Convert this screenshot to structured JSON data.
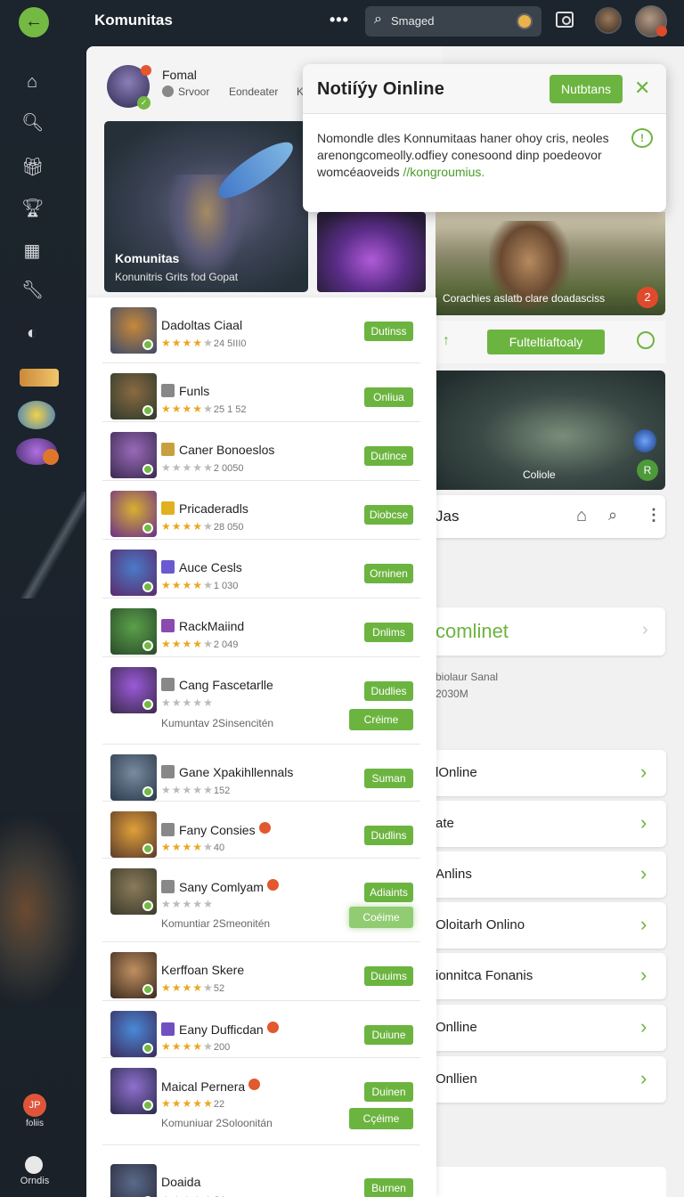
{
  "topbar": {
    "title": "Komunitas",
    "more_glyph": "•••",
    "search_value": "Smaged",
    "icons": [
      "back-arrow-icon",
      "search-icon",
      "screen-icon",
      "avatar"
    ]
  },
  "sidebar": {
    "icons": [
      "home-icon",
      "search-icon",
      "gift-icon",
      "trophy-icon",
      "calendar-icon",
      "wrench-icon",
      "globe-icon"
    ],
    "bottom_badge": "JP",
    "bottom_label1": "foliis",
    "bottom_label2": "Orndis"
  },
  "profile": {
    "name": "Fomal",
    "status": "Srvoor",
    "tab2": "Eondeater",
    "tab3": "K"
  },
  "banner": {
    "title": "Komunitas",
    "subtitle": "Konunitris Grits fod Gopat"
  },
  "notification": {
    "title": "Notiíýy Oinline",
    "button": "Nutbtans",
    "close": "✕",
    "body": "Nomondle dles Konnumitaas haner ohoy cris, neoles arenongcomeolly.odfiey conesoond dinp poedeovor womcéaoveids",
    "link": "//kongroumius."
  },
  "right": {
    "img1_caption": "Corachies aslatb clare doadasciss",
    "img1_badge": "2",
    "cta": "Fulteltiaftoaly",
    "img2_caption": "Coliole",
    "img2_badge": "R",
    "nav_title": "Jas",
    "online_title": "comlinet",
    "meta1": "biolaur Sanal",
    "meta2": "2030M",
    "rows": [
      "lOnline",
      "ate",
      "Anlins",
      "Oloitarh Onlino",
      "ionnitca Fonanis",
      "Onlline",
      "Onllien"
    ]
  },
  "list": [
    {
      "name": "Dadoltas Ciaal",
      "rating": 4,
      "count": "24 5III0",
      "button": "Dutinss"
    },
    {
      "name": "Funls",
      "rating": 4,
      "count": "25 1 52",
      "button": "Onliua"
    },
    {
      "name": "Caner Bonoeslos",
      "rating": 0,
      "count": "2 0050",
      "button": "Dutince"
    },
    {
      "name": "Pricaderadls",
      "rating": 4,
      "count": "28 050",
      "button": "Diobcse"
    },
    {
      "name": "Auce Cesls",
      "rating": 4,
      "count": "1 030",
      "button": "Orninen"
    },
    {
      "name": "RackMaiind",
      "rating": 4,
      "count": "2 049",
      "button": "Dnlims"
    },
    {
      "name": "Cang Fascetarlle",
      "rating": 0,
      "count": "",
      "button": "Dudlies",
      "meta": "Kumuntav 2Sinsencitén",
      "extra": "Créime"
    },
    {
      "name": "Gane Xpakihllennals",
      "rating": 0,
      "count": "152",
      "button": "Suman"
    },
    {
      "name": "Fany Consies",
      "rating": 4,
      "count": "40",
      "button": "Dudlins"
    },
    {
      "name": "Sany Comlyam",
      "rating": 0,
      "count": "",
      "button": "Adiaints",
      "meta": "Komuntiar 2Smeonitén",
      "extra": "Coéime"
    },
    {
      "name": "Kerffoan Skere",
      "rating": 4,
      "count": "52",
      "button": "Duuims"
    },
    {
      "name": "Eany Dufficdan",
      "rating": 4,
      "count": "200",
      "button": "Duiune"
    },
    {
      "name": "Maical Pernera",
      "rating": 5,
      "count": "22",
      "button": "Duinen",
      "meta": "Komuniuar 2Soloonitán",
      "extra": "Cçéime"
    },
    {
      "name": "Doaida",
      "rating": 0,
      "count": "S1",
      "button": "Burnen"
    }
  ],
  "colors": {
    "accent": "#6cb440",
    "sidebar": "#1c242d",
    "badge": "#e04a2c"
  }
}
